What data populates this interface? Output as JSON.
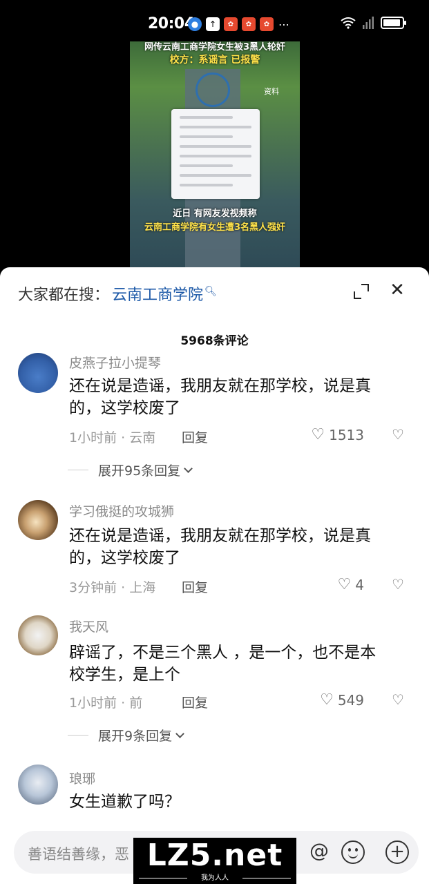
{
  "status_bar": {
    "time": "20:04",
    "icons": [
      "browser-icon",
      "upload-icon",
      "app-icon",
      "app-icon",
      "app-icon",
      "more-icon",
      "wifi-icon",
      "signal-icon",
      "battery-icon"
    ]
  },
  "video": {
    "caption_top_line1": "网传云南工商学院女生被3黑人轮奸",
    "caption_top_line2": "校方：系谣言 已报警",
    "label": "资料",
    "caption_bottom_line1": "近日 有网友发视频称",
    "caption_bottom_line2": "云南工商学院有女生遭3名黑人强奸"
  },
  "sheet": {
    "search_prefix": "大家都在搜：",
    "search_term": "云南工商学院",
    "comment_count": "5968条评论"
  },
  "comments": [
    {
      "user": "皮燕子拉小提琴",
      "text": "还在说是造谣，我朋友就在那学校，说是真的，这学校废了",
      "meta": "1小时前 · 云南",
      "reply": "回复",
      "likes": "1513",
      "expand": "展开95条回复"
    },
    {
      "user": "学习俄挺的攻城狮",
      "text": "还在说是造谣，我朋友就在那学校，说是真的，这学校废了",
      "meta": "3分钟前 · 上海",
      "reply": "回复",
      "likes": "4"
    },
    {
      "user": "我天风",
      "text": "辟谣了，不是三个黑人 ，是一个，也不是本校学生，是上个",
      "meta": "1小时前 · 前",
      "reply": "回复",
      "likes": "549",
      "expand": "展开9条回复"
    },
    {
      "user": "琅琊",
      "text": "女生道歉了吗？"
    }
  ],
  "input": {
    "placeholder": "善语结善缘，恶"
  },
  "watermark": {
    "text": "LZ5.net",
    "sub": "我为人人"
  }
}
